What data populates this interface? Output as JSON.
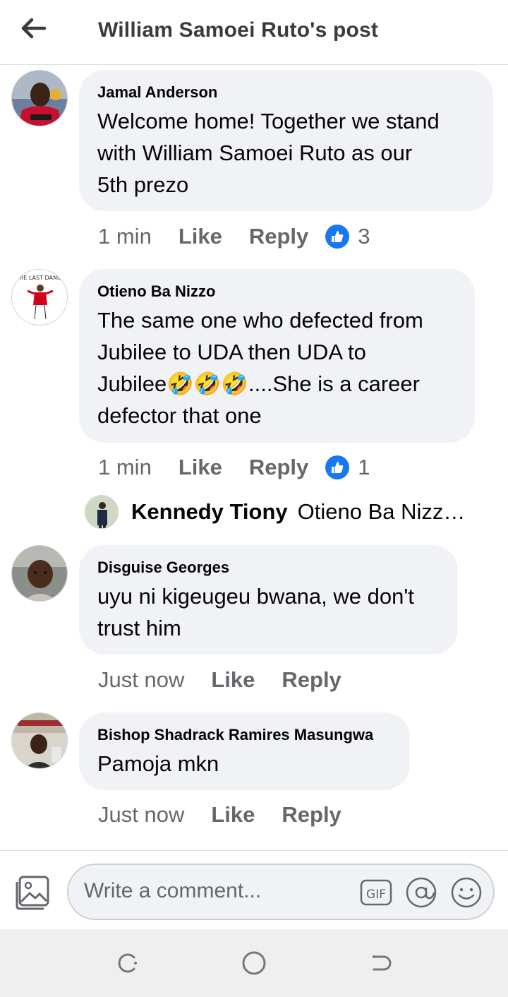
{
  "header": {
    "title": "William Samoei Ruto's post",
    "back_icon": "arrow-left-icon"
  },
  "comments": [
    {
      "author": "Jamal Anderson",
      "text_lines": [
        "Welcome home! Together we stand",
        "with William Samoei Ruto as our",
        "5th prezo"
      ],
      "time": "1 min",
      "like_label": "Like",
      "reply_label": "Reply",
      "reactions": "3"
    },
    {
      "author": "Otieno Ba Nizzo",
      "text_lines": [
        "The same one who defected from",
        "Jubilee to UDA then UDA to",
        "Jubilee🤣🤣🤣....She is a career",
        "defector that one"
      ],
      "time": "1 min",
      "like_label": "Like",
      "reply_label": "Reply",
      "reactions": "1"
    },
    {
      "author": "Disguise Georges",
      "text_lines": [
        "uyu ni kigeugeu bwana, we don't",
        "trust him"
      ],
      "time": "Just now",
      "like_label": "Like",
      "reply_label": "Reply"
    },
    {
      "author": "Bishop Shadrack Ramires Masungwa",
      "text_lines": [
        "Pamoja mkn"
      ],
      "time": "Just now",
      "like_label": "Like",
      "reply_label": "Reply"
    }
  ],
  "reply_preview": {
    "author": "Kennedy Tiony",
    "text": "Otieno Ba Nizz…"
  },
  "composer": {
    "placeholder": "Write a comment...",
    "photo_icon": "photo-icon",
    "gif_label": "GIF",
    "mention_icon": "at-icon",
    "emoji_icon": "smiley-icon"
  },
  "colors": {
    "brand_blue": "#1877f2",
    "bubble_bg": "#f0f2f5",
    "secondary_text": "#65676b"
  }
}
